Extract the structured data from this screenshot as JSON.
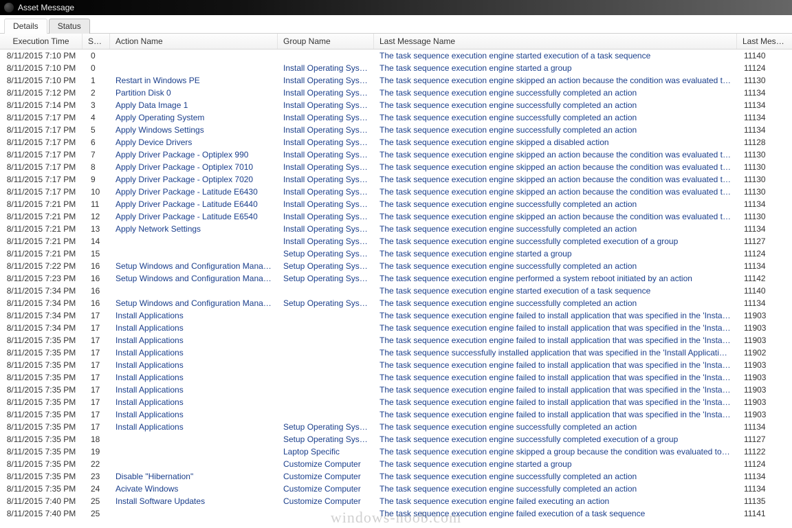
{
  "window": {
    "title": "Asset Message"
  },
  "tabs": [
    {
      "label": "Details",
      "active": false
    },
    {
      "label": "Status",
      "active": true
    }
  ],
  "columns": {
    "time": "Execution Time",
    "step": "Step",
    "action": "Action Name",
    "group": "Group Name",
    "message": "Last Message Name",
    "msgid": "Last Message ID"
  },
  "sort_indicator": "▲",
  "watermark": "windows-noob.com",
  "rows": [
    {
      "time": "8/11/2015 7:10 PM",
      "step": "0",
      "action": "",
      "group": "",
      "message": "The task sequence execution engine started execution of a task sequence",
      "msgid": "11140"
    },
    {
      "time": "8/11/2015 7:10 PM",
      "step": "0",
      "action": "",
      "group": "Install Operating System",
      "message": "The task sequence execution engine started a group",
      "msgid": "11124"
    },
    {
      "time": "8/11/2015 7:10 PM",
      "step": "1",
      "action": "Restart in Windows PE",
      "group": "Install Operating System",
      "message": "The task sequence execution engine skipped an action because the condition was evaluated to be false",
      "msgid": "11130"
    },
    {
      "time": "8/11/2015 7:12 PM",
      "step": "2",
      "action": "Partition Disk 0",
      "group": "Install Operating System",
      "message": "The task sequence execution engine successfully completed an action",
      "msgid": "11134"
    },
    {
      "time": "8/11/2015 7:14 PM",
      "step": "3",
      "action": "Apply Data Image 1",
      "group": "Install Operating System",
      "message": "The task sequence execution engine successfully completed an action",
      "msgid": "11134"
    },
    {
      "time": "8/11/2015 7:17 PM",
      "step": "4",
      "action": "Apply Operating System",
      "group": "Install Operating System",
      "message": "The task sequence execution engine successfully completed an action",
      "msgid": "11134"
    },
    {
      "time": "8/11/2015 7:17 PM",
      "step": "5",
      "action": "Apply Windows Settings",
      "group": "Install Operating System",
      "message": "The task sequence execution engine successfully completed an action",
      "msgid": "11134"
    },
    {
      "time": "8/11/2015 7:17 PM",
      "step": "6",
      "action": "Apply Device Drivers",
      "group": "Install Operating System",
      "message": "The task sequence execution engine skipped a disabled action",
      "msgid": "11128"
    },
    {
      "time": "8/11/2015 7:17 PM",
      "step": "7",
      "action": "Apply Driver Package - Optiplex 990",
      "group": "Install Operating System",
      "message": "The task sequence execution engine skipped an action because the condition was evaluated to be false",
      "msgid": "11130"
    },
    {
      "time": "8/11/2015 7:17 PM",
      "step": "8",
      "action": "Apply Driver Package - Optiplex 7010",
      "group": "Install Operating System",
      "message": "The task sequence execution engine skipped an action because the condition was evaluated to be false",
      "msgid": "11130"
    },
    {
      "time": "8/11/2015 7:17 PM",
      "step": "9",
      "action": "Apply Driver Package - Optiplex 7020",
      "group": "Install Operating System",
      "message": "The task sequence execution engine skipped an action because the condition was evaluated to be false",
      "msgid": "11130"
    },
    {
      "time": "8/11/2015 7:17 PM",
      "step": "10",
      "action": "Apply Driver Package - Latitude E6430",
      "group": "Install Operating System",
      "message": "The task sequence execution engine skipped an action because the condition was evaluated to be false",
      "msgid": "11130"
    },
    {
      "time": "8/11/2015 7:21 PM",
      "step": "11",
      "action": "Apply Driver Package - Latitude E6440",
      "group": "Install Operating System",
      "message": "The task sequence execution engine successfully completed an action",
      "msgid": "11134"
    },
    {
      "time": "8/11/2015 7:21 PM",
      "step": "12",
      "action": "Apply Driver Package - Latitude E6540",
      "group": "Install Operating System",
      "message": "The task sequence execution engine skipped an action because the condition was evaluated to be false",
      "msgid": "11130"
    },
    {
      "time": "8/11/2015 7:21 PM",
      "step": "13",
      "action": "Apply Network Settings",
      "group": "Install Operating System",
      "message": "The task sequence execution engine successfully completed an action",
      "msgid": "11134"
    },
    {
      "time": "8/11/2015 7:21 PM",
      "step": "14",
      "action": "",
      "group": "Install Operating System",
      "message": "The task sequence execution engine successfully completed execution of a group",
      "msgid": "11127"
    },
    {
      "time": "8/11/2015 7:21 PM",
      "step": "15",
      "action": "",
      "group": "Setup Operating System",
      "message": "The task sequence execution engine started a group",
      "msgid": "11124"
    },
    {
      "time": "8/11/2015 7:22 PM",
      "step": "16",
      "action": "Setup Windows and Configuration Manager",
      "group": "Setup Operating System",
      "message": "The task sequence execution engine successfully completed an action",
      "msgid": "11134"
    },
    {
      "time": "8/11/2015 7:23 PM",
      "step": "16",
      "action": "Setup Windows and Configuration Manager",
      "group": "Setup Operating System",
      "message": "The task sequence execution engine performed a system reboot initiated by an action",
      "msgid": "11142"
    },
    {
      "time": "8/11/2015 7:34 PM",
      "step": "16",
      "action": "",
      "group": "",
      "message": "The task sequence execution engine started execution of a task sequence",
      "msgid": "11140"
    },
    {
      "time": "8/11/2015 7:34 PM",
      "step": "16",
      "action": "Setup Windows and Configuration Manager",
      "group": "Setup Operating System",
      "message": "The task sequence execution engine successfully completed an action",
      "msgid": "11134"
    },
    {
      "time": "8/11/2015 7:34 PM",
      "step": "17",
      "action": "Install Applications",
      "group": "",
      "message": "The task sequence execution engine failed to install application that was specified in the 'Install Aplication' action.",
      "msgid": "11903"
    },
    {
      "time": "8/11/2015 7:34 PM",
      "step": "17",
      "action": "Install Applications",
      "group": "",
      "message": "The task sequence execution engine failed to install application that was specified in the 'Install Aplication' action.",
      "msgid": "11903"
    },
    {
      "time": "8/11/2015 7:35 PM",
      "step": "17",
      "action": "Install Applications",
      "group": "",
      "message": "The task sequence execution engine failed to install application that was specified in the 'Install Aplication' action.",
      "msgid": "11903"
    },
    {
      "time": "8/11/2015 7:35 PM",
      "step": "17",
      "action": "Install Applications",
      "group": "",
      "message": "The task sequence successfully installed application that was specified in the 'Install Application' action.",
      "msgid": "11902"
    },
    {
      "time": "8/11/2015 7:35 PM",
      "step": "17",
      "action": "Install Applications",
      "group": "",
      "message": "The task sequence execution engine failed to install application that was specified in the 'Install Aplication' action.",
      "msgid": "11903"
    },
    {
      "time": "8/11/2015 7:35 PM",
      "step": "17",
      "action": "Install Applications",
      "group": "",
      "message": "The task sequence execution engine failed to install application that was specified in the 'Install Aplication' action.",
      "msgid": "11903"
    },
    {
      "time": "8/11/2015 7:35 PM",
      "step": "17",
      "action": "Install Applications",
      "group": "",
      "message": "The task sequence execution engine failed to install application that was specified in the 'Install Aplication' action.",
      "msgid": "11903"
    },
    {
      "time": "8/11/2015 7:35 PM",
      "step": "17",
      "action": "Install Applications",
      "group": "",
      "message": "The task sequence execution engine failed to install application that was specified in the 'Install Aplication' action.",
      "msgid": "11903"
    },
    {
      "time": "8/11/2015 7:35 PM",
      "step": "17",
      "action": "Install Applications",
      "group": "",
      "message": "The task sequence execution engine failed to install application that was specified in the 'Install Aplication' action.",
      "msgid": "11903"
    },
    {
      "time": "8/11/2015 7:35 PM",
      "step": "17",
      "action": "Install Applications",
      "group": "Setup Operating System",
      "message": "The task sequence execution engine successfully completed an action",
      "msgid": "11134"
    },
    {
      "time": "8/11/2015 7:35 PM",
      "step": "18",
      "action": "",
      "group": "Setup Operating System",
      "message": "The task sequence execution engine successfully completed execution of a group",
      "msgid": "11127"
    },
    {
      "time": "8/11/2015 7:35 PM",
      "step": "19",
      "action": "",
      "group": "Laptop Specific",
      "message": "The task sequence execution engine skipped a group because the condition was evaluated to be false",
      "msgid": "11122"
    },
    {
      "time": "8/11/2015 7:35 PM",
      "step": "22",
      "action": "",
      "group": "Customize Computer",
      "message": "The task sequence execution engine started a group",
      "msgid": "11124"
    },
    {
      "time": "8/11/2015 7:35 PM",
      "step": "23",
      "action": "Disable \"Hibernation\"",
      "group": "Customize Computer",
      "message": "The task sequence execution engine successfully completed an action",
      "msgid": "11134"
    },
    {
      "time": "8/11/2015 7:35 PM",
      "step": "24",
      "action": "Acivate Windows",
      "group": "Customize Computer",
      "message": "The task sequence execution engine successfully completed an action",
      "msgid": "11134"
    },
    {
      "time": "8/11/2015 7:40 PM",
      "step": "25",
      "action": "Install Software Updates",
      "group": "Customize Computer",
      "message": "The task sequence execution engine failed executing an action",
      "msgid": "11135"
    },
    {
      "time": "8/11/2015 7:40 PM",
      "step": "25",
      "action": "",
      "group": "",
      "message": "The task sequence execution engine failed execution of a task sequence",
      "msgid": "11141"
    }
  ]
}
